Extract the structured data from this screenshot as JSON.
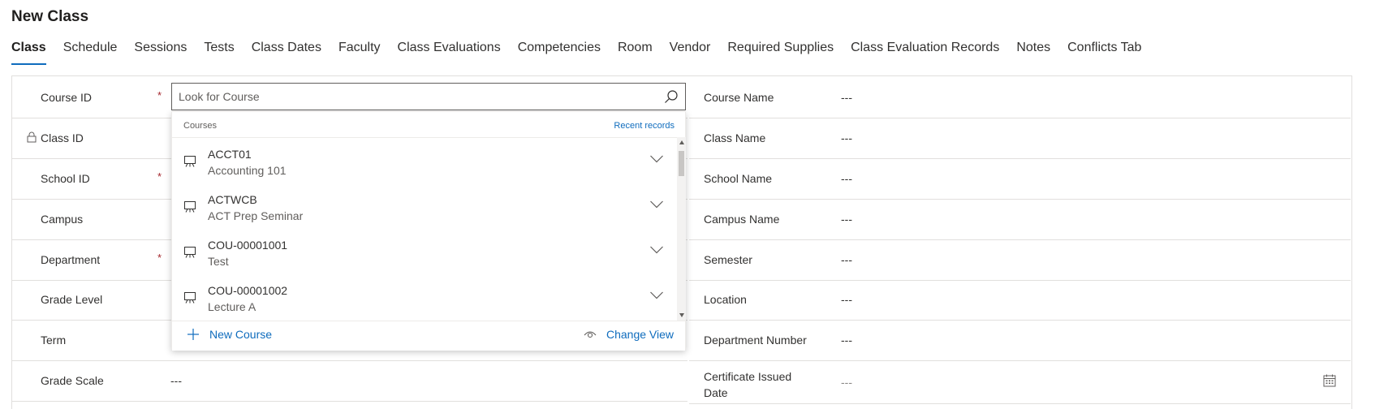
{
  "page": {
    "title": "New Class"
  },
  "tabs": [
    {
      "label": "Class"
    },
    {
      "label": "Schedule"
    },
    {
      "label": "Sessions"
    },
    {
      "label": "Tests"
    },
    {
      "label": "Class Dates"
    },
    {
      "label": "Faculty"
    },
    {
      "label": "Class Evaluations"
    },
    {
      "label": "Competencies"
    },
    {
      "label": "Room"
    },
    {
      "label": "Vendor"
    },
    {
      "label": "Required Supplies"
    },
    {
      "label": "Class Evaluation Records"
    },
    {
      "label": "Notes"
    },
    {
      "label": "Conflicts Tab"
    }
  ],
  "left_fields": {
    "course_id": "Course ID",
    "class_id": "Class ID",
    "school_id": "School ID",
    "campus": "Campus",
    "department": "Department",
    "grade_level": "Grade Level",
    "term": "Term",
    "grade_scale": "Grade Scale",
    "grade_scale_value": "---",
    "required_marker": "*"
  },
  "right_fields": [
    {
      "label": "Course Name",
      "value": "---"
    },
    {
      "label": "Class Name",
      "value": "---"
    },
    {
      "label": "School Name",
      "value": "---"
    },
    {
      "label": "Campus Name",
      "value": "---"
    },
    {
      "label": "Semester",
      "value": "---"
    },
    {
      "label": "Location",
      "value": "---"
    },
    {
      "label": "Department Number",
      "value": "---"
    }
  ],
  "certificate": {
    "label_line1": "Certificate Issued",
    "label_line2": "Date",
    "value": "---"
  },
  "lookup": {
    "placeholder": "Look for Course",
    "header_title": "Courses",
    "recent_records": "Recent records",
    "items": [
      {
        "code": "ACCT01",
        "name": "Accounting 101"
      },
      {
        "code": "ACTWCB",
        "name": "ACT Prep Seminar"
      },
      {
        "code": "COU-00001001",
        "name": "Test"
      },
      {
        "code": "COU-00001002",
        "name": "Lecture A"
      }
    ],
    "new_label": "New Course",
    "change_view_label": "Change View"
  },
  "colors": {
    "accent": "#0f6cbd",
    "required": "#a4262c",
    "border": "#e1dfdd"
  }
}
